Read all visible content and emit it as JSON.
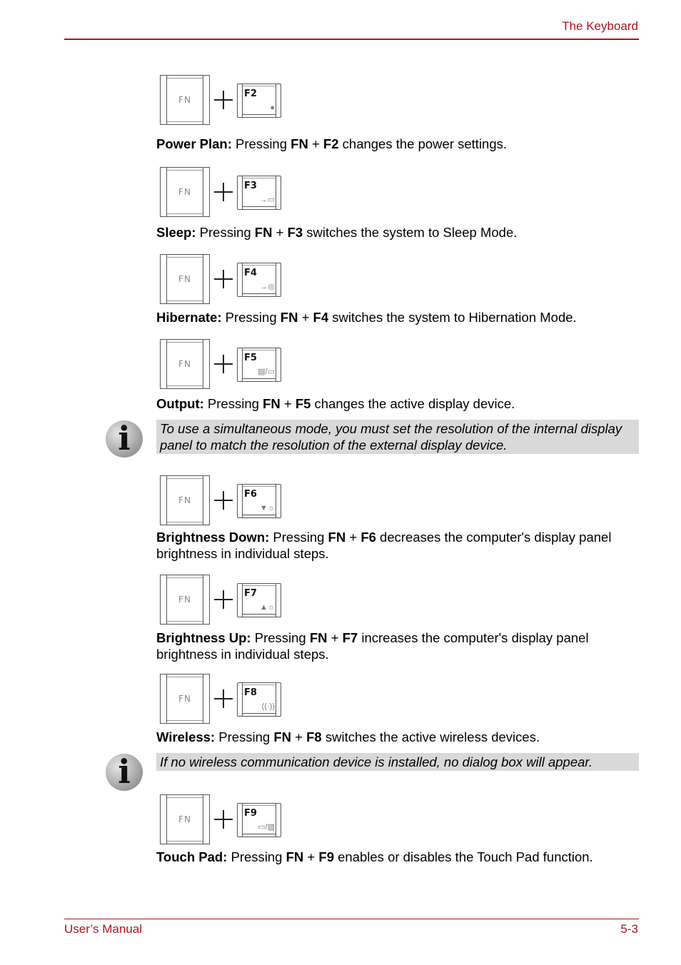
{
  "header": {
    "title": "The Keyboard"
  },
  "footer": {
    "left": "User’s Manual",
    "right": "5-3"
  },
  "fn_label": "FN",
  "entries": [
    {
      "key": "F2",
      "icon": "●",
      "title": "Power Plan:",
      "t1": " Pressing ",
      "fn": "FN",
      "plus": " + ",
      "fk": "F2",
      "rest": " changes the power settings."
    },
    {
      "key": "F3",
      "icon": "→▭",
      "title": "Sleep:",
      "t1": " Pressing ",
      "fn": "FN",
      "plus": " + ",
      "fk": "F3",
      "rest": " switches the system to Sleep Mode."
    },
    {
      "key": "F4",
      "icon": "→◎",
      "title": "Hibernate:",
      "t1": " Pressing ",
      "fn": "FN",
      "plus": " + ",
      "fk": "F4",
      "rest": " switches the system to Hibernation Mode."
    },
    {
      "key": "F5",
      "icon": "▤/▭",
      "title": "Output:",
      "t1": " Pressing ",
      "fn": "FN",
      "plus": " + ",
      "fk": "F5",
      "rest": " changes the active display device."
    },
    {
      "key": "F6",
      "icon": "▼☼",
      "title": "Brightness Down:",
      "t1": " Pressing ",
      "fn": "FN",
      "plus": " + ",
      "fk": "F6",
      "rest": " decreases the computer's display panel brightness in individual steps."
    },
    {
      "key": "F7",
      "icon": "▲☼",
      "title": "Brightness Up:",
      "t1": " Pressing ",
      "fn": "FN",
      "plus": " + ",
      "fk": "F7",
      "rest": " increases the computer's display panel brightness in individual steps."
    },
    {
      "key": "F8",
      "icon": "((·))",
      "title": "Wireless:",
      "t1": " Pressing ",
      "fn": "FN",
      "plus": " + ",
      "fk": "F8",
      "rest": " switches the active wireless devices."
    },
    {
      "key": "F9",
      "icon": "▭/▧",
      "title": "Touch Pad:",
      "t1": " Pressing ",
      "fn": "FN",
      "plus": " + ",
      "fk": "F9",
      "rest": " enables or disables the Touch Pad function."
    }
  ],
  "notes": [
    {
      "icon": "i",
      "text": "To use a simultaneous mode, you must set the resolution of the internal display panel to match the resolution of the external display device."
    },
    {
      "icon": "i",
      "text": "If no wireless communication device is installed, no dialog box will appear."
    }
  ]
}
